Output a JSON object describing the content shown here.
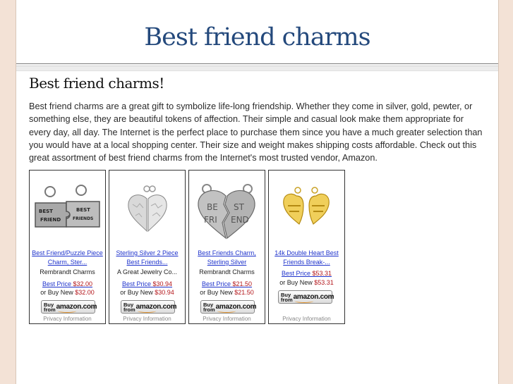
{
  "site": {
    "title": "Best friend charms"
  },
  "post": {
    "title": "Best friend charms!",
    "body": "Best friend charms are a great gift to symbolize life-long friendship. Whether they come in silver, gold, pewter, or something else, they are beautiful tokens of affection. Their simple and casual look make them appropriate for every day, all day. The Internet is the perfect place to purchase them since you have a much greater selection than you would have at a local shopping center. Their size and weight makes shipping costs affordable. Check out this great assortment of best friend charms from the Internet's most trusted vendor, Amazon."
  },
  "products": [
    {
      "name": "Best Friend/Puzzle Piece Charm, Ster...",
      "merchant": "Rembrandt Charms",
      "best_price_label": "Best Price",
      "best_price": "$32.00",
      "new_label": "or Buy New",
      "new_price": "$32.00",
      "buy_button_top": "Buy from",
      "buy_button_brand": "amazon.com",
      "privacy": "Privacy Information",
      "image_text": [
        "BEST",
        "FRIEND",
        "BEST",
        "FRIENDS"
      ]
    },
    {
      "name": "Sterling Silver 2 Piece Best Friends...",
      "merchant": "A Great Jewelry Co...",
      "best_price_label": "Best Price",
      "best_price": "$30.94",
      "new_label": "or Buy New",
      "new_price": "$30.94",
      "buy_button_top": "Buy from",
      "buy_button_brand": "amazon.com",
      "privacy": "Privacy Information"
    },
    {
      "name": "Best Friends Charm, Sterling Silver",
      "merchant": "Rembrandt Charms",
      "best_price_label": "Best Price",
      "best_price": "$21.50",
      "new_label": "or Buy New",
      "new_price": "$21.50",
      "buy_button_top": "Buy from",
      "buy_button_brand": "amazon.com",
      "privacy": "Privacy Information",
      "image_text": [
        "BE",
        "ST",
        "FRI",
        "END"
      ]
    },
    {
      "name": "14k Double Heart Best Friends Break-...",
      "best_price_label": "Best Price",
      "best_price": "$53.31",
      "new_label": "or Buy New",
      "new_price": "$53.31",
      "buy_button_top": "Buy from",
      "buy_button_brand": "amazon.com",
      "privacy": "Privacy Information"
    }
  ],
  "colors": {
    "title": "#24497c",
    "link": "#1f33cc",
    "price": "#b3151a",
    "background": "#f3e2d6"
  }
}
